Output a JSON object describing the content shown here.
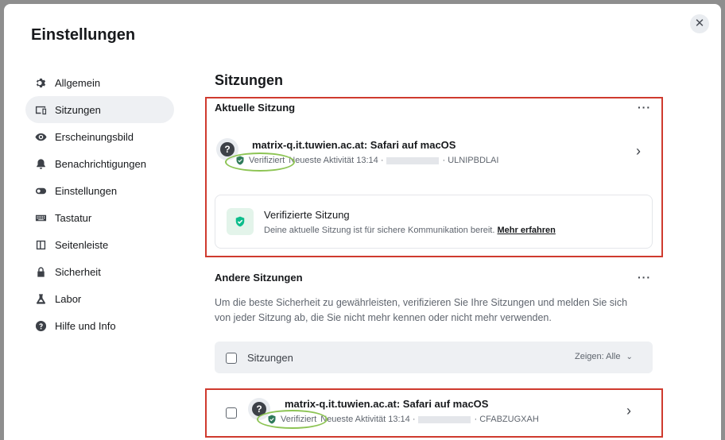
{
  "dialog": {
    "title": "Einstellungen",
    "close_label": "✕"
  },
  "sidebar": {
    "items": [
      {
        "label": "Allgemein"
      },
      {
        "label": "Sitzungen"
      },
      {
        "label": "Erscheinungsbild"
      },
      {
        "label": "Benachrichtigungen"
      },
      {
        "label": "Einstellungen"
      },
      {
        "label": "Tastatur"
      },
      {
        "label": "Seitenleiste"
      },
      {
        "label": "Sicherheit"
      },
      {
        "label": "Labor"
      },
      {
        "label": "Hilfe und Info"
      }
    ]
  },
  "main": {
    "title": "Sitzungen",
    "current": {
      "heading": "Aktuelle Sitzung",
      "more": "···",
      "session": {
        "name": "matrix-q.it.tuwien.ac.at: Safari auf macOS",
        "status": "Verifiziert",
        "activity": "Neueste Aktivität 13:14 ·",
        "device_id": "· ULNIPBDLAI"
      },
      "verified_card": {
        "title": "Verifizierte Sitzung",
        "text": "Deine aktuelle Sitzung ist für sichere Kommunikation bereit.",
        "link": "Mehr erfahren"
      }
    },
    "other": {
      "heading": "Andere Sitzungen",
      "more": "···",
      "description_line1": "Um die beste Sicherheit zu gewährleisten, verifizieren Sie Ihre Sitzungen und melden Sie sich",
      "description_line2": "von jeder Sitzung ab, die Sie nicht mehr kennen oder nicht mehr verwenden.",
      "filter": {
        "label": "Sitzungen",
        "show": "Zeigen: Alle"
      },
      "session": {
        "name": "matrix-q.it.tuwien.ac.at: Safari auf macOS",
        "status": "Verifiziert",
        "activity": "Neueste Aktivität 13:14 ·",
        "device_id": "· CFABZUGXAH"
      }
    }
  },
  "colors": {
    "accent_green": "#0dbd8b",
    "highlight_red": "#cf3a2e",
    "annotation_green": "#8dc454"
  }
}
